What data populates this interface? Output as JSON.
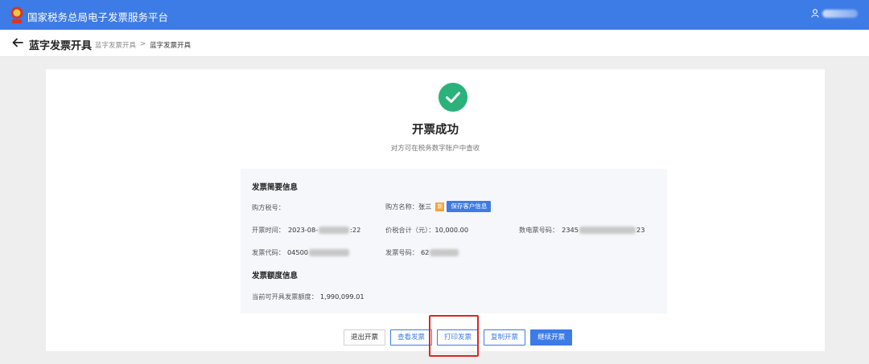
{
  "topbar": {
    "app_title": "国家税务总局电子发票服务平台",
    "user_icon": "user-icon",
    "brand_color": "#3d7be6"
  },
  "subheader": {
    "title": "蓝字发票开具",
    "breadcrumb": [
      "蓝字发票开具",
      "蓝字发票开具"
    ],
    "separator": ">"
  },
  "result": {
    "icon": "check-circle-icon",
    "title": "开票成功",
    "subtitle": "对方可在税务数字账户中查收",
    "success_color": "#2bb27b"
  },
  "invoice_summary": {
    "section_title": "发票简要信息",
    "buyer_tax_id_label": "购方税号：",
    "buyer_name_label": "购方名称：",
    "buyer_name_value": "张三",
    "new_tag": "新",
    "save_customer_button": "保存客户信息",
    "issue_time_label": "开票时间：",
    "issue_time_prefix": "2023-08-",
    "issue_time_suffix": ":22",
    "total_label": "价税合计（元）：",
    "total_value": "10,000.00",
    "digital_no_label": "数电票号码：",
    "digital_no_prefix": "2345",
    "digital_no_suffix": "23",
    "invoice_code_label": "发票代码：",
    "invoice_code_prefix": "04500",
    "invoice_no_label": "发票号码：",
    "invoice_no_prefix": "62"
  },
  "quota": {
    "section_title": "发票额度信息",
    "available_label": "当前可开具发票额度：",
    "available_value": "1,990,099.01"
  },
  "actions": {
    "exit": "退出开票",
    "view": "查看发票",
    "print": "打印发票",
    "copy": "复制开票",
    "continue": "继续开票"
  },
  "annotation_color": "#e02424"
}
